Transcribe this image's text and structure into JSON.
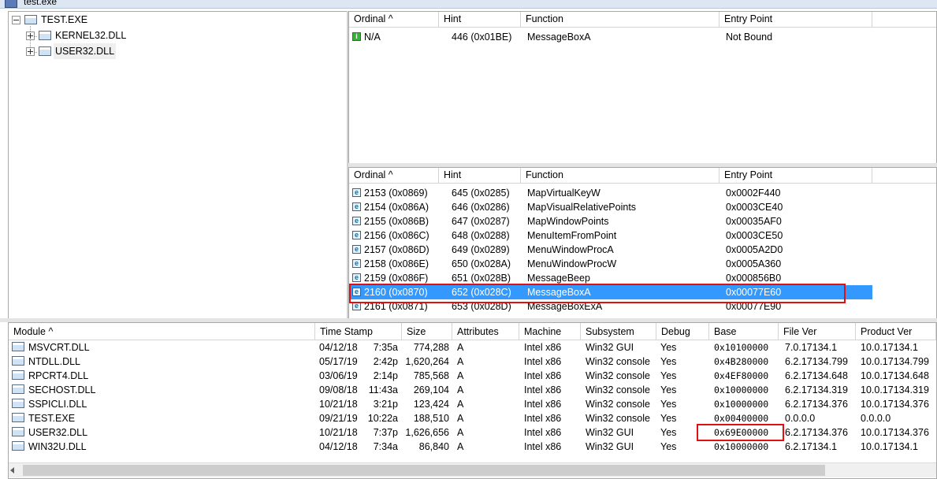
{
  "window": {
    "title": "test.exe"
  },
  "tree": {
    "root": "TEST.EXE",
    "children": [
      "KERNEL32.DLL",
      "USER32.DLL"
    ]
  },
  "imports": {
    "headers": [
      "Ordinal ^",
      "Hint",
      "Function",
      "Entry Point"
    ],
    "rows": [
      {
        "icon": "i",
        "ordinal": "N/A",
        "hint": "446  (0x01BE)",
        "function": "MessageBoxA",
        "entry": "Not Bound"
      }
    ]
  },
  "exports": {
    "headers": [
      "Ordinal ^",
      "Hint",
      "Function",
      "Entry Point"
    ],
    "rows": [
      {
        "icon": "e",
        "ordinal": "2153  (0x0869)",
        "hint": "645  (0x0285)",
        "function": "MapVirtualKeyW",
        "entry": "0x0002F440"
      },
      {
        "icon": "e",
        "ordinal": "2154  (0x086A)",
        "hint": "646  (0x0286)",
        "function": "MapVisualRelativePoints",
        "entry": "0x0003CE40"
      },
      {
        "icon": "e",
        "ordinal": "2155  (0x086B)",
        "hint": "647  (0x0287)",
        "function": "MapWindowPoints",
        "entry": "0x00035AF0"
      },
      {
        "icon": "e",
        "ordinal": "2156  (0x086C)",
        "hint": "648  (0x0288)",
        "function": "MenuItemFromPoint",
        "entry": "0x0003CE50"
      },
      {
        "icon": "e",
        "ordinal": "2157  (0x086D)",
        "hint": "649  (0x0289)",
        "function": "MenuWindowProcA",
        "entry": "0x0005A2D0"
      },
      {
        "icon": "e",
        "ordinal": "2158  (0x086E)",
        "hint": "650  (0x028A)",
        "function": "MenuWindowProcW",
        "entry": "0x0005A360"
      },
      {
        "icon": "e",
        "ordinal": "2159  (0x086F)",
        "hint": "651  (0x028B)",
        "function": "MessageBeep",
        "entry": "0x000856B0"
      },
      {
        "icon": "e",
        "ordinal": "2160  (0x0870)",
        "hint": "652  (0x028C)",
        "function": "MessageBoxA",
        "entry": "0x00077E60",
        "selected": true
      },
      {
        "icon": "e",
        "ordinal": "2161  (0x0871)",
        "hint": "653  (0x028D)",
        "function": "MessageBoxExA",
        "entry": "0x00077E90"
      }
    ]
  },
  "modules": {
    "headers": [
      "Module ^",
      "Time Stamp",
      "Size",
      "Attributes",
      "Machine",
      "Subsystem",
      "Debug",
      "Base",
      "File Ver",
      "Product Ver"
    ],
    "rows": [
      {
        "module": "MSVCRT.DLL",
        "date": "04/12/18",
        "time": "7:35a",
        "size": "774,288",
        "attr": "A",
        "machine": "Intel x86",
        "subsystem": "Win32 GUI",
        "debug": "Yes",
        "base": "0x10100000",
        "filever": "7.0.17134.1",
        "prodver": "10.0.17134.1"
      },
      {
        "module": "NTDLL.DLL",
        "date": "05/17/19",
        "time": "2:42p",
        "size": "1,620,264",
        "attr": "A",
        "machine": "Intel x86",
        "subsystem": "Win32 console",
        "debug": "Yes",
        "base": "0x4B280000",
        "filever": "6.2.17134.799",
        "prodver": "10.0.17134.799"
      },
      {
        "module": "RPCRT4.DLL",
        "date": "03/06/19",
        "time": "2:14p",
        "size": "785,568",
        "attr": "A",
        "machine": "Intel x86",
        "subsystem": "Win32 console",
        "debug": "Yes",
        "base": "0x4EF80000",
        "filever": "6.2.17134.648",
        "prodver": "10.0.17134.648"
      },
      {
        "module": "SECHOST.DLL",
        "date": "09/08/18",
        "time": "11:43a",
        "size": "269,104",
        "attr": "A",
        "machine": "Intel x86",
        "subsystem": "Win32 console",
        "debug": "Yes",
        "base": "0x10000000",
        "filever": "6.2.17134.319",
        "prodver": "10.0.17134.319"
      },
      {
        "module": "SSPICLI.DLL",
        "date": "10/21/18",
        "time": "3:21p",
        "size": "123,424",
        "attr": "A",
        "machine": "Intel x86",
        "subsystem": "Win32 console",
        "debug": "Yes",
        "base": "0x10000000",
        "filever": "6.2.17134.376",
        "prodver": "10.0.17134.376"
      },
      {
        "module": "TEST.EXE",
        "date": "09/21/19",
        "time": "10:22a",
        "size": "188,510",
        "attr": "A",
        "machine": "Intel x86",
        "subsystem": "Win32 console",
        "debug": "Yes",
        "base": "0x00400000",
        "filever": "0.0.0.0",
        "prodver": "0.0.0.0"
      },
      {
        "module": "USER32.DLL",
        "date": "10/21/18",
        "time": "7:37p",
        "size": "1,626,656",
        "attr": "A",
        "machine": "Intel x86",
        "subsystem": "Win32 GUI",
        "debug": "Yes",
        "base": "0x69E00000",
        "filever": "6.2.17134.376",
        "prodver": "10.0.17134.376"
      },
      {
        "module": "WIN32U.DLL",
        "date": "04/12/18",
        "time": "7:34a",
        "size": "86,840",
        "attr": "A",
        "machine": "Intel x86",
        "subsystem": "Win32 GUI",
        "debug": "Yes",
        "base": "0x10000000",
        "filever": "6.2.17134.1",
        "prodver": "10.0.17134.1"
      }
    ]
  },
  "colors": {
    "selection": "#3399ff",
    "highlight_box": "#e01010"
  }
}
